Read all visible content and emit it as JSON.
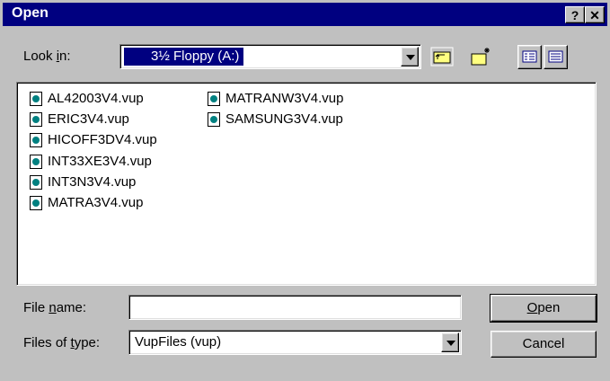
{
  "window": {
    "title": "Open",
    "help_label": "?",
    "close_label": "✕"
  },
  "lookin": {
    "label_pre": "Look ",
    "label_ul": "i",
    "label_post": "n:",
    "value": "3½ Floppy (A:)",
    "icon": "floppy-drive-icon"
  },
  "toolbar": {
    "up_icon": "up-one-level-icon",
    "newfolder_icon": "create-new-folder-icon",
    "list_icon": "list-view-icon",
    "details_icon": "details-view-icon"
  },
  "files": [
    "AL42003V4.vup",
    "ERIC3V4.vup",
    "HICOFF3DV4.vup",
    "INT33XE3V4.vup",
    "INT3N3V4.vup",
    "MATRA3V4.vup",
    "MATRANW3V4.vup",
    "SAMSUNG3V4.vup"
  ],
  "filename": {
    "label_pre": "File ",
    "label_ul": "n",
    "label_post": "ame:",
    "value": ""
  },
  "filetype": {
    "label_pre": "Files of ",
    "label_ul": "t",
    "label_post": "ype:",
    "value": "VupFiles (vup)"
  },
  "buttons": {
    "open_ul": "O",
    "open_rest": "pen",
    "cancel": "Cancel"
  }
}
